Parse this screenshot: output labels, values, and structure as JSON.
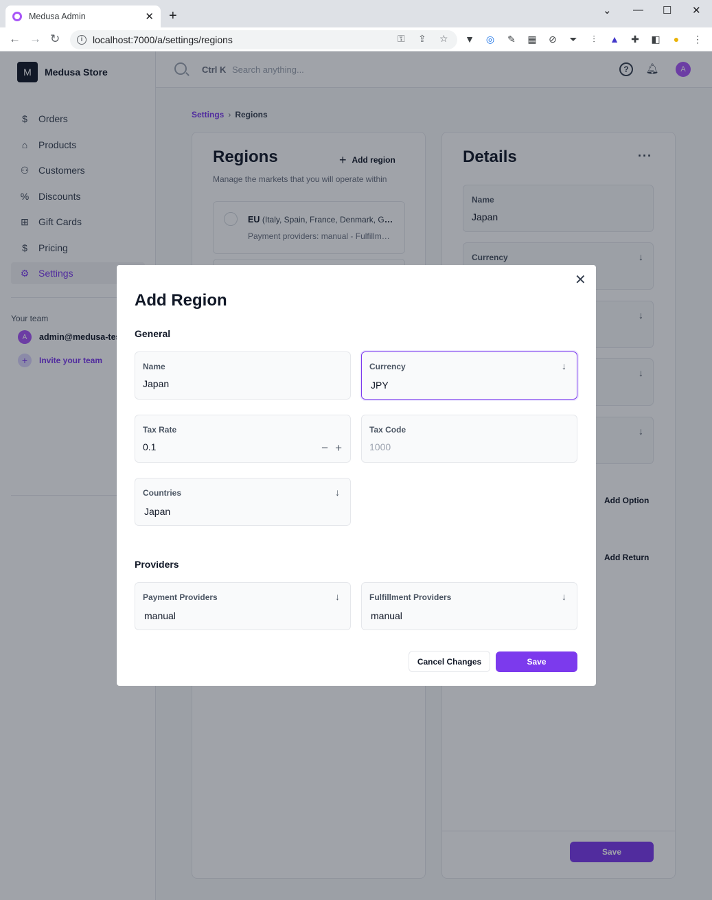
{
  "browser": {
    "tab_title": "Medusa Admin",
    "url": "localhost:7000/a/settings/regions"
  },
  "sidebar": {
    "store_initial": "M",
    "store_name": "Medusa Store",
    "items": [
      {
        "label": "Orders",
        "icon": "dollar-icon"
      },
      {
        "label": "Products",
        "icon": "tag-icon"
      },
      {
        "label": "Customers",
        "icon": "user-icon"
      },
      {
        "label": "Discounts",
        "icon": "discount-icon"
      },
      {
        "label": "Gift Cards",
        "icon": "gift-icon"
      },
      {
        "label": "Pricing",
        "icon": "coin-icon"
      },
      {
        "label": "Settings",
        "icon": "gear-icon"
      }
    ],
    "team_label": "Your team",
    "member_initial": "A",
    "member_email": "admin@medusa-test",
    "invite_label": "Invite your team"
  },
  "topbar": {
    "shortcut": "Ctrl K",
    "search_placeholder": "Search anything...",
    "avatar_initial": "A"
  },
  "breadcrumb": {
    "parent": "Settings",
    "current": "Regions"
  },
  "regions": {
    "title": "Regions",
    "add_label": "Add region",
    "subtitle": "Manage the markets that you will operate within",
    "items": [
      {
        "name": "EU",
        "countries": "(Italy, Spain, France, Denmark, Ge...",
        "providers": "Payment providers: manual - Fulfillme..."
      }
    ]
  },
  "details": {
    "title": "Details",
    "name_label": "Name",
    "name_value": "Japan",
    "currency_label": "Currency",
    "add_option_label": "Add Option",
    "add_return_label": "Add Return",
    "save_label": "Save"
  },
  "modal": {
    "title": "Add Region",
    "general_section": "General",
    "providers_section": "Providers",
    "name": {
      "label": "Name",
      "value": "Japan"
    },
    "currency": {
      "label": "Currency",
      "value": "JPY"
    },
    "tax_rate": {
      "label": "Tax Rate",
      "value": "0.1"
    },
    "tax_code": {
      "label": "Tax Code",
      "placeholder": "1000"
    },
    "countries": {
      "label": "Countries",
      "value": "Japan"
    },
    "payment_providers": {
      "label": "Payment Providers",
      "value": "manual"
    },
    "fulfillment_providers": {
      "label": "Fulfillment Providers",
      "value": "manual"
    },
    "cancel_label": "Cancel Changes",
    "save_label": "Save"
  },
  "colors": {
    "accent": "#7c3aed",
    "avatar": "#a855f7"
  }
}
